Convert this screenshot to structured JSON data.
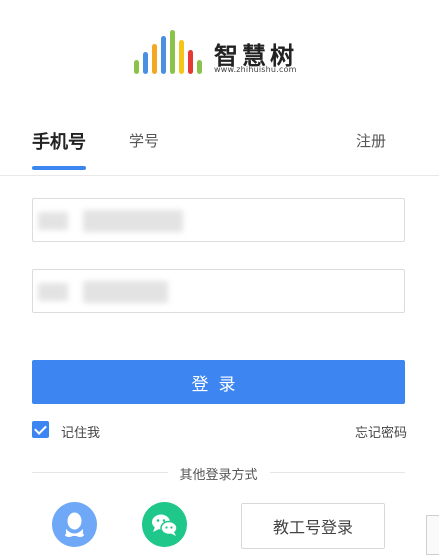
{
  "logo": {
    "name": "智慧树",
    "url": "www.zhihuishu.com",
    "bar_colors": [
      "#8bc34a",
      "#4a90e2",
      "#f5a623",
      "#4a90e2",
      "#8bc34a",
      "#f5c518",
      "#e53935",
      "#8bc34a"
    ]
  },
  "tabs": {
    "phone": "手机号",
    "student_id": "学号",
    "register": "注册"
  },
  "form": {
    "phone_value": "",
    "password_value": ""
  },
  "login_button": "登录",
  "remember": {
    "label": "记住我",
    "checked": true
  },
  "forgot_password": "忘记密码",
  "other_login": {
    "divider": "其他登录方式",
    "qq_icon": "qq-icon",
    "wechat_icon": "wechat-icon",
    "staff_button": "教工号登录"
  },
  "colors": {
    "accent": "#3d85f0",
    "qq": "#6fa8f7",
    "wechat": "#1fc88a"
  }
}
